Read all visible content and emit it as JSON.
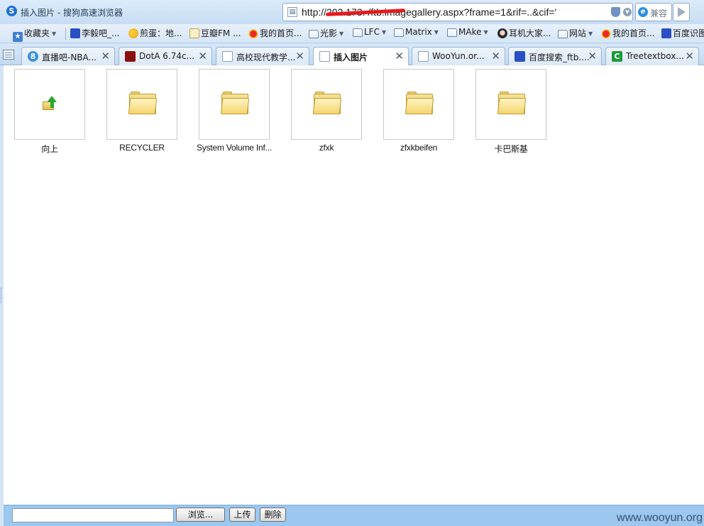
{
  "window": {
    "title": "插入图片 - 搜狗高速浏览器"
  },
  "address": {
    "url": "http://202.173.          /ftb.imagegallery.aspx?frame=1&rif=..&cif='"
  },
  "toolbar": {
    "compat_label": "兼容"
  },
  "favorites": [
    {
      "label": "收藏夹",
      "icon": "star-icon",
      "caret": true
    },
    {
      "label": "李毅吧_...",
      "icon": "paw-icon"
    },
    {
      "label": "煎蛋：地...",
      "icon": "egg-icon"
    },
    {
      "label": "豆瓣FM ...",
      "icon": "radio-icon"
    },
    {
      "label": "我的首页...",
      "icon": "weibo-icon"
    },
    {
      "label": "光影",
      "icon": "folder-icon",
      "caret": true
    },
    {
      "label": "LFC",
      "icon": "folder-icon",
      "caret": true
    },
    {
      "label": "Matrix",
      "icon": "folder-icon",
      "caret": true
    },
    {
      "label": "MAke",
      "icon": "folder-icon",
      "caret": true
    },
    {
      "label": "耳机大家...",
      "icon": "face-icon"
    },
    {
      "label": "网站",
      "icon": "folder-icon",
      "caret": true
    },
    {
      "label": "我的首页...",
      "icon": "weibo-icon"
    },
    {
      "label": "百度识图",
      "icon": "paw-icon"
    }
  ],
  "tabs": [
    {
      "label": "直播吧-NBA...",
      "icon": "zhibo8-icon",
      "active": false
    },
    {
      "label": "DotA 6.74c...",
      "icon": "dota-icon",
      "active": false
    },
    {
      "label": "高校现代教学...",
      "icon": "page-icon",
      "active": false
    },
    {
      "label": "插入图片",
      "icon": "page-icon",
      "active": true
    },
    {
      "label": "WooYun.or...",
      "icon": "page-icon",
      "active": false
    },
    {
      "label": "百度搜索_ftb....",
      "icon": "paw-icon",
      "active": false
    },
    {
      "label": "Treetextbox...",
      "icon": "c-icon",
      "active": false
    }
  ],
  "files": [
    {
      "name": "向上",
      "type": "up"
    },
    {
      "name": "RECYCLER",
      "type": "folder"
    },
    {
      "name": "System Volume Inf...",
      "type": "folder"
    },
    {
      "name": "zfxk",
      "type": "folder"
    },
    {
      "name": "zfxkbeifen",
      "type": "folder"
    },
    {
      "name": "卡巴斯基",
      "type": "folder"
    }
  ],
  "upload": {
    "browse_label": "浏览...",
    "upload_label": "上传",
    "delete_label": "删除"
  },
  "watermark": "www.wooyun.org",
  "colors": {
    "accent": "#1d6fd2",
    "bottom_bar": "#9cc7ef",
    "redaction": "#e8191d"
  }
}
